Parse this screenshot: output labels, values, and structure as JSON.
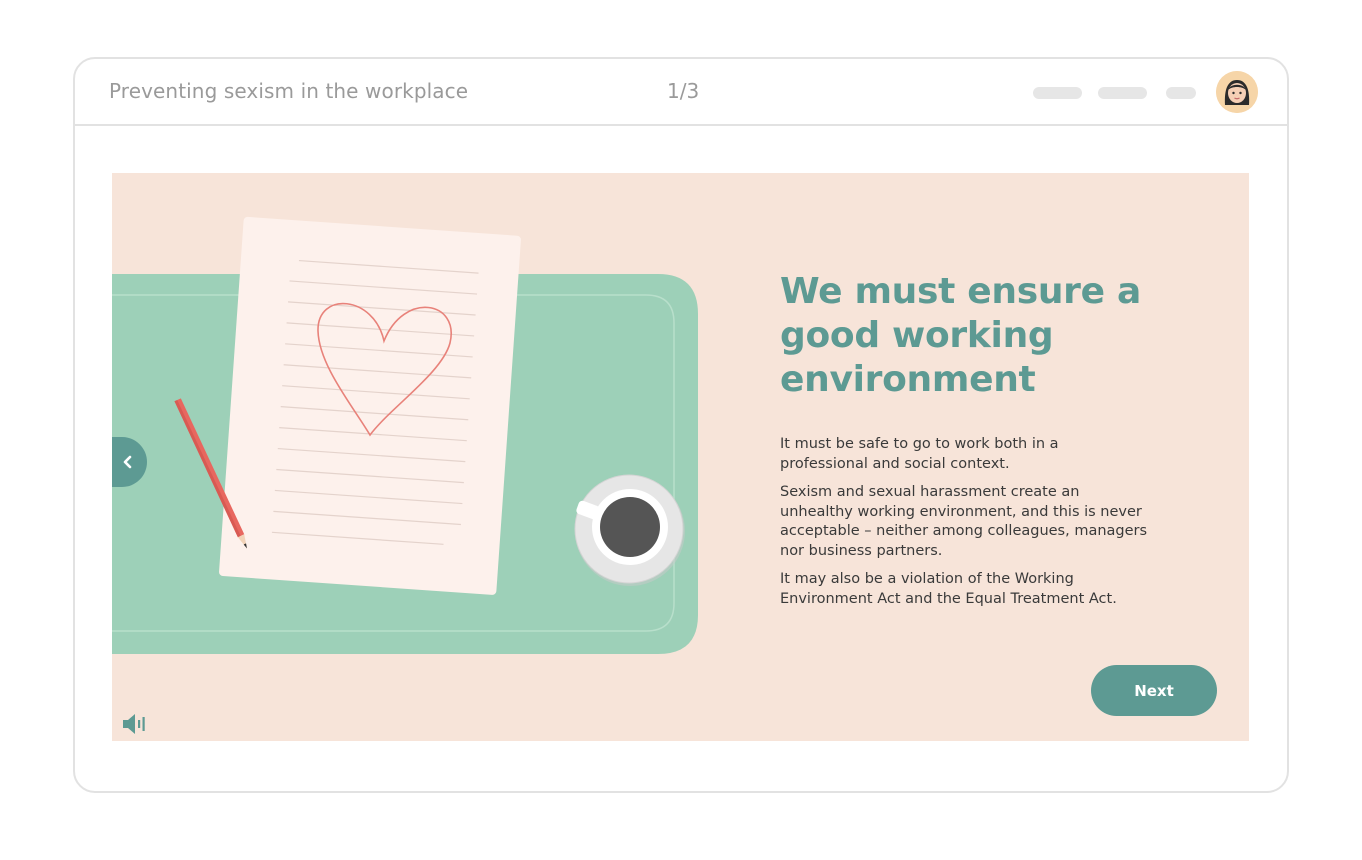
{
  "header": {
    "course_title": "Preventing sexism in the workplace",
    "page_indicator": "1/3",
    "avatar_icon": "user-avatar-woman"
  },
  "slide": {
    "heading": "We must ensure a good working environment",
    "paragraphs": [
      "It must be safe to go to work both in a professional and social context.",
      "Sexism and sexual harassment create an unhealthy working environment, and this is never acceptable – neither among colleagues, managers nor business partners.",
      "It may also be a violation of the Working Environment Act and the Equal Treatment Act."
    ],
    "next_label": "Next",
    "prev_icon": "chevron-left-icon",
    "audio_icon": "speaker-icon"
  },
  "colors": {
    "accent": "#5d9a93",
    "slide_background": "#f7e4d9",
    "mat": "#9dd0b8",
    "paper": "#fdf1ec",
    "heart": "#e8827a",
    "pencil": "#e8675f"
  }
}
